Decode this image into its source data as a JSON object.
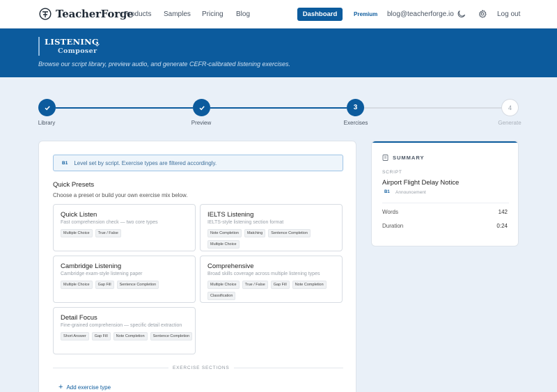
{
  "brand": {
    "name": "TeacherForge"
  },
  "nav": {
    "links": [
      "Products",
      "Samples",
      "Pricing",
      "Blog"
    ],
    "dashboard": "Dashboard",
    "premium": "Premium",
    "email": "blog@teacherforge.io",
    "logout": "Log out"
  },
  "hero": {
    "title": "LISTENING",
    "subtitle": "Composer",
    "description": "Browse our script library, preview audio, and generate CEFR-calibrated listening exercises."
  },
  "stepper": {
    "steps": [
      {
        "label": "Library",
        "state": "done"
      },
      {
        "label": "Preview",
        "state": "done"
      },
      {
        "label": "Exercises",
        "number": "3",
        "state": "current"
      },
      {
        "label": "Generate",
        "number": "4",
        "state": "pending"
      }
    ]
  },
  "main": {
    "level_note": {
      "badge": "B1",
      "text": "Level set by script. Exercise types are filtered accordingly."
    },
    "presets_title": "Quick Presets",
    "presets_desc": "Choose a preset or build your own exercise mix below.",
    "presets": [
      {
        "name": "Quick Listen",
        "desc": "Fast comprehension check — two core types",
        "tags": [
          "Multiple Choice",
          "True / False"
        ]
      },
      {
        "name": "IELTS Listening",
        "desc": "IELTS-style listening section format",
        "tags": [
          "Note Completion",
          "Matching",
          "Sentence Completion",
          "Multiple Choice"
        ]
      },
      {
        "name": "Cambridge Listening",
        "desc": "Cambridge exam-style listening paper",
        "tags": [
          "Multiple Choice",
          "Gap Fill",
          "Sentence Completion"
        ]
      },
      {
        "name": "Comprehensive",
        "desc": "Broad skills coverage across multiple listening types",
        "tags": [
          "Multiple Choice",
          "True / False",
          "Gap Fill",
          "Note Completion",
          "Classification"
        ]
      },
      {
        "name": "Detail Focus",
        "desc": "Fine-grained comprehension — specific detail extraction",
        "tags": [
          "Short Answer",
          "Gap Fill",
          "Note Completion",
          "Sentence Completion"
        ]
      }
    ],
    "sections_label": "EXERCISE SECTIONS",
    "add_type": "Add exercise type"
  },
  "summary": {
    "heading": "SUMMARY",
    "script_label": "SCRIPT",
    "script_title": "Airport Flight Delay Notice",
    "script_level": "B1",
    "script_type": "Announcement",
    "words_label": "Words",
    "words_value": "142",
    "duration_label": "Duration",
    "duration_value": "0:24"
  },
  "colors": {
    "accent": "#0c5b9d",
    "background": "#e9f0f8"
  }
}
